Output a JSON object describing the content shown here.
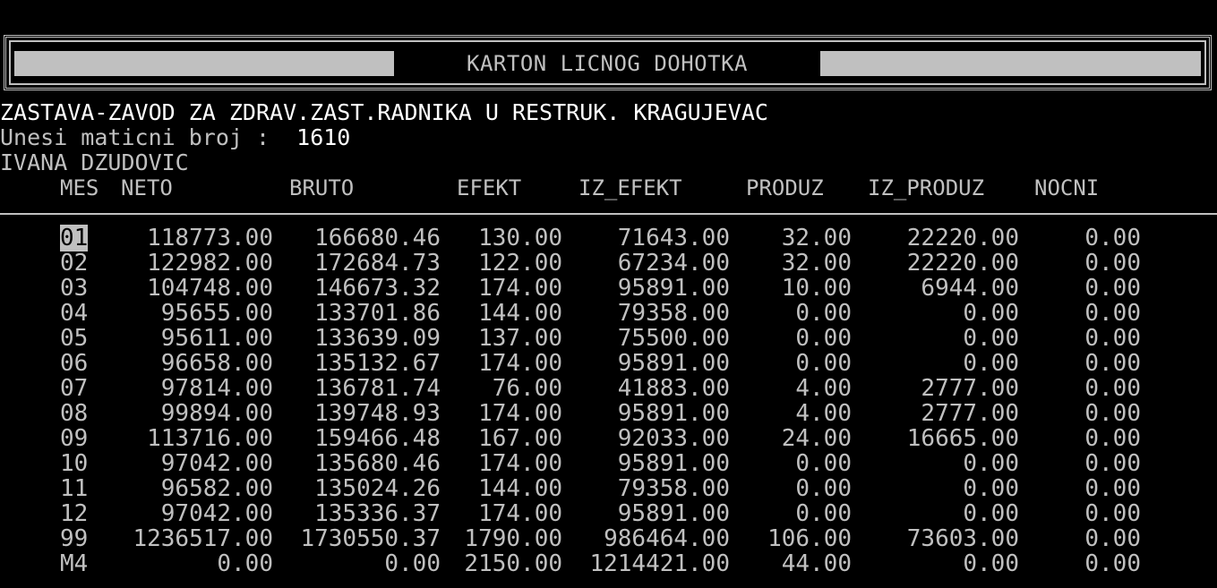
{
  "screen": {
    "title": "KARTON LICNOG DOHOTKA",
    "company": "ZASTAVA-ZAVOD ZA ZDRAV.ZAST.RADNIKA U RESTRUK. KRAGUJEVAC",
    "prompt_label": "Unesi maticni broj :",
    "prompt_value": "1610",
    "person_name": "IVANA DZUDOVIC"
  },
  "colors": {
    "background": "#000000",
    "text": "#c0c0c0",
    "highlight": "#ffffff"
  },
  "table": {
    "columns": [
      "MES",
      "NETO",
      "BRUTO",
      "EFEKT",
      "IZ_EFEKT",
      "PRODUZ",
      "IZ_PRODUZ",
      "NOCNI"
    ],
    "rows": [
      [
        "01",
        "118773.00",
        "166680.46",
        "130.00",
        "71643.00",
        "32.00",
        "22220.00",
        "0.00"
      ],
      [
        "02",
        "122982.00",
        "172684.73",
        "122.00",
        "67234.00",
        "32.00",
        "22220.00",
        "0.00"
      ],
      [
        "03",
        "104748.00",
        "146673.32",
        "174.00",
        "95891.00",
        "10.00",
        "6944.00",
        "0.00"
      ],
      [
        "04",
        "95655.00",
        "133701.86",
        "144.00",
        "79358.00",
        "0.00",
        "0.00",
        "0.00"
      ],
      [
        "05",
        "95611.00",
        "133639.09",
        "137.00",
        "75500.00",
        "0.00",
        "0.00",
        "0.00"
      ],
      [
        "06",
        "96658.00",
        "135132.67",
        "174.00",
        "95891.00",
        "0.00",
        "0.00",
        "0.00"
      ],
      [
        "07",
        "97814.00",
        "136781.74",
        "76.00",
        "41883.00",
        "4.00",
        "2777.00",
        "0.00"
      ],
      [
        "08",
        "99894.00",
        "139748.93",
        "174.00",
        "95891.00",
        "4.00",
        "2777.00",
        "0.00"
      ],
      [
        "09",
        "113716.00",
        "159466.48",
        "167.00",
        "92033.00",
        "24.00",
        "16665.00",
        "0.00"
      ],
      [
        "10",
        "97042.00",
        "135680.46",
        "174.00",
        "95891.00",
        "0.00",
        "0.00",
        "0.00"
      ],
      [
        "11",
        "96582.00",
        "135024.26",
        "144.00",
        "79358.00",
        "0.00",
        "0.00",
        "0.00"
      ],
      [
        "12",
        "97042.00",
        "135336.37",
        "174.00",
        "95891.00",
        "0.00",
        "0.00",
        "0.00"
      ],
      [
        "99",
        "1236517.00",
        "1730550.37",
        "1790.00",
        "986464.00",
        "106.00",
        "73603.00",
        "0.00"
      ],
      [
        "M4",
        "0.00",
        "0.00",
        "2150.00",
        "1214421.00",
        "44.00",
        "0.00",
        "0.00"
      ]
    ]
  }
}
